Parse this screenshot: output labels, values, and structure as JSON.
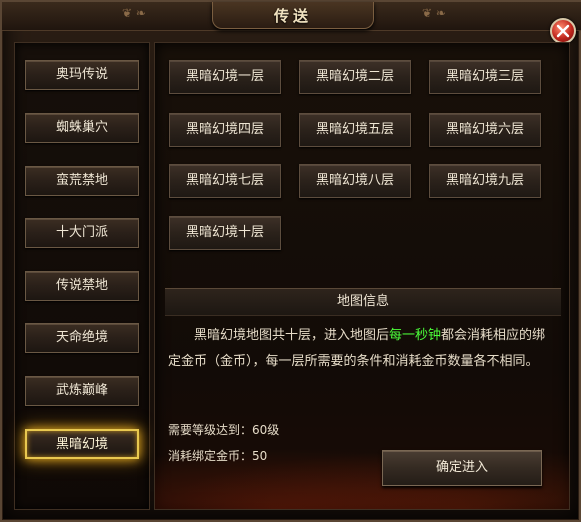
{
  "window": {
    "title": "传送"
  },
  "locations": [
    {
      "label": "奥玛传说",
      "active": false
    },
    {
      "label": "蜘蛛巢穴",
      "active": false
    },
    {
      "label": "蛮荒禁地",
      "active": false
    },
    {
      "label": "十大门派",
      "active": false
    },
    {
      "label": "传说禁地",
      "active": false
    },
    {
      "label": "天命绝境",
      "active": false
    },
    {
      "label": "武炼巅峰",
      "active": false
    },
    {
      "label": "黑暗幻境",
      "active": true
    }
  ],
  "layers": [
    "黑暗幻境一层",
    "黑暗幻境二层",
    "黑暗幻境三层",
    "黑暗幻境四层",
    "黑暗幻境五层",
    "黑暗幻境六层",
    "黑暗幻境七层",
    "黑暗幻境八层",
    "黑暗幻境九层",
    "黑暗幻境十层"
  ],
  "info": {
    "header": "地图信息",
    "desc_part1": "黑暗幻境地图共十层，进入地图后",
    "desc_highlight": "每一秒钟",
    "desc_part2": "都会消耗相应的绑定金币（金币），每一层所需要的条件和消耗金币数量各不相同。",
    "highlight_color": "#4cff3a"
  },
  "requirements": {
    "level_label": "需要等级达到：",
    "level_value": "60级",
    "cost_label": "消耗绑定金币：",
    "cost_value": "50"
  },
  "confirm_label": "确定进入",
  "icons": {
    "close": "close-icon"
  }
}
